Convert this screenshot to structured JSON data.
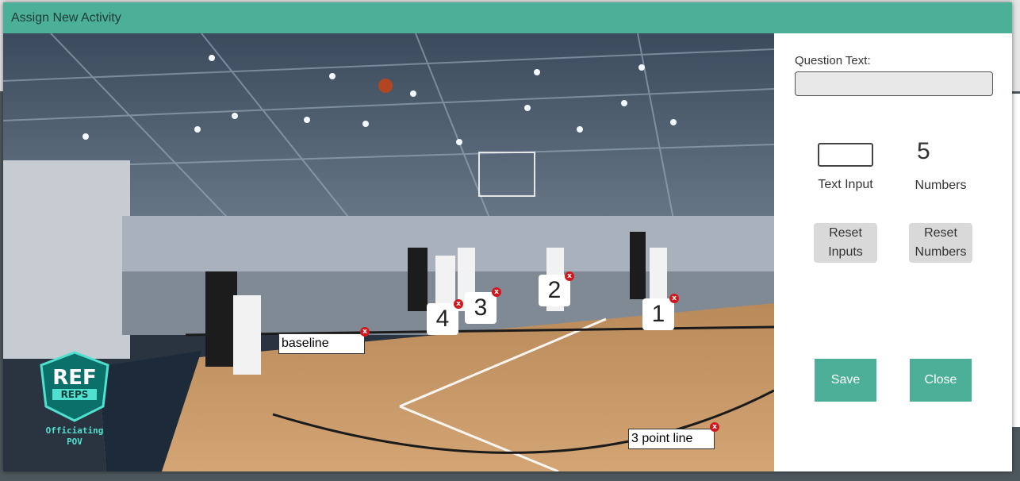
{
  "dialog": {
    "title": "Assign New Activity"
  },
  "video": {
    "logo": {
      "line1": "REF",
      "line2": "REPS",
      "line3": "Officiating",
      "line4": "POV"
    },
    "text_tags": [
      {
        "label": "baseline",
        "remove": "x"
      },
      {
        "label": "3 point line",
        "remove": "x"
      }
    ],
    "number_tags": [
      {
        "label": "1",
        "remove": "x"
      },
      {
        "label": "2",
        "remove": "x"
      },
      {
        "label": "3",
        "remove": "x"
      },
      {
        "label": "4",
        "remove": "x"
      }
    ]
  },
  "panel": {
    "question_label": "Question Text:",
    "question_value": "",
    "text_input_label": "Text Input",
    "numbers_count": "5",
    "numbers_label": "Numbers",
    "reset_inputs_line1": "Reset",
    "reset_inputs_line2": "Inputs",
    "reset_numbers_line1": "Reset",
    "reset_numbers_line2": "Numbers",
    "save_label": "Save",
    "close_label": "Close"
  },
  "colors": {
    "header": "#4caf98",
    "button_primary": "#4caf98",
    "remove_icon": "#d1181f"
  }
}
